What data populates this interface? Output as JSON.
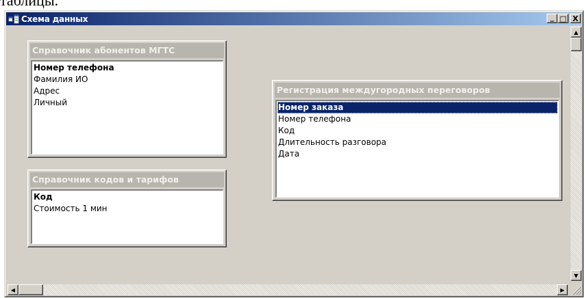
{
  "document_fragment": "таблицы.",
  "window": {
    "title": "Схема данных",
    "minimize": "_",
    "maximize": "□",
    "close": "X"
  },
  "tables": [
    {
      "caption": "Справочник абонентов МГТС",
      "fields": [
        {
          "name": "Номер телефона",
          "primary_key": true,
          "selected": false
        },
        {
          "name": "Фамилия ИО",
          "primary_key": false,
          "selected": false
        },
        {
          "name": "Адрес",
          "primary_key": false,
          "selected": false
        },
        {
          "name": "Личный",
          "primary_key": false,
          "selected": false
        }
      ]
    },
    {
      "caption": "Справочник кодов и тарифов",
      "fields": [
        {
          "name": "Код",
          "primary_key": true,
          "selected": false
        },
        {
          "name": "Стоимость 1 мин",
          "primary_key": false,
          "selected": false
        }
      ]
    },
    {
      "caption": "Регистрация междугородных переговоров",
      "fields": [
        {
          "name": "Номер заказа",
          "primary_key": true,
          "selected": true
        },
        {
          "name": "Номер телефона",
          "primary_key": false,
          "selected": false
        },
        {
          "name": "Код",
          "primary_key": false,
          "selected": false
        },
        {
          "name": "Длительность разговора",
          "primary_key": false,
          "selected": false
        },
        {
          "name": "Дата",
          "primary_key": false,
          "selected": false
        }
      ]
    }
  ],
  "scrollbars": {
    "up_arrow": "▲",
    "down_arrow": "▼",
    "left_arrow": "◀",
    "right_arrow": "▶"
  },
  "colors": {
    "title_gradient_start": "#0a246a",
    "title_gradient_end": "#a6caf0",
    "selection": "#0a246a",
    "face": "#d4d0c8"
  }
}
